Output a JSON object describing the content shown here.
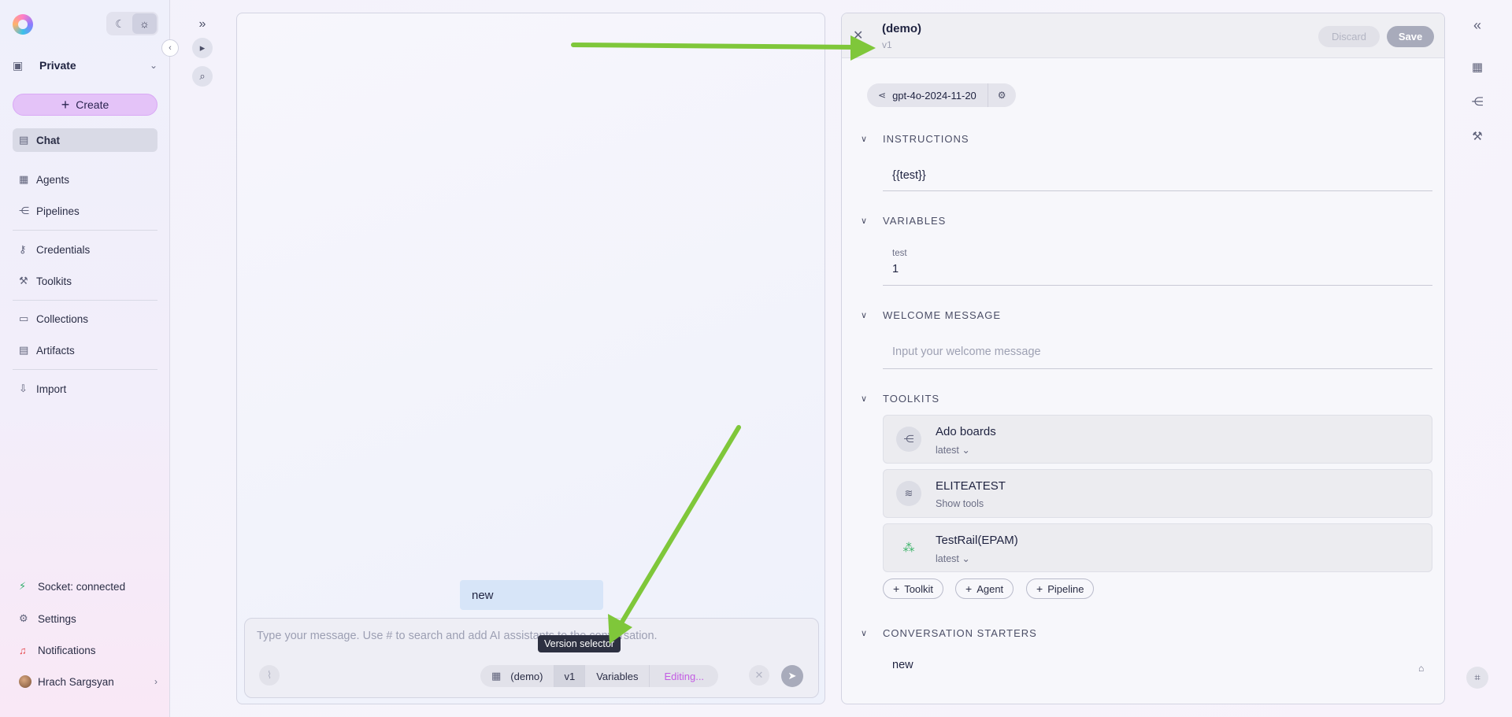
{
  "sidebar": {
    "theme": {
      "dark_icon": "moon-icon",
      "light_icon": "sun-icon"
    },
    "project": "Private",
    "create_label": "Create",
    "nav": {
      "chat": "Chat",
      "agents": "Agents",
      "pipelines": "Pipelines",
      "credentials": "Credentials",
      "toolkits": "Toolkits",
      "collections": "Collections",
      "artifacts": "Artifacts",
      "import": "Import"
    },
    "bottom": {
      "socket": "Socket: connected",
      "settings": "Settings",
      "notifications": "Notifications",
      "user": "Hrach Sargsyan"
    }
  },
  "chat": {
    "message": "new",
    "input_placeholder": "Type your message. Use # to search and add AI assistants to the conversation.",
    "chips": {
      "agent": "(demo)",
      "version": "v1",
      "variables": "Variables",
      "status": "Editing..."
    },
    "tooltip": "Version selector"
  },
  "editor": {
    "agent_name": "(demo)",
    "version": "v1",
    "discard_label": "Discard",
    "save_label": "Save",
    "model": "gpt-4o-2024-11-20",
    "sections": {
      "instructions": "INSTRUCTIONS",
      "variables": "VARIABLES",
      "welcome": "WELCOME MESSAGE",
      "toolkits": "TOOLKITS",
      "starters": "CONVERSATION STARTERS"
    },
    "instructions_value": "{{test}}",
    "variable": {
      "name": "test",
      "value": "1"
    },
    "welcome_placeholder": "Input your welcome message",
    "toolkits": [
      {
        "name": "Ado boards",
        "sub": "latest",
        "icon": "pipeline-icon"
      },
      {
        "name": "ELITEATEST",
        "sub": "Show tools",
        "icon": "mcp-icon"
      },
      {
        "name": "TestRail(EPAM)",
        "sub": "latest",
        "icon": "testrail-icon"
      }
    ],
    "add_buttons": {
      "toolkit": "Toolkit",
      "agent": "Agent",
      "pipeline": "Pipeline"
    },
    "starter": "new"
  },
  "colors": {
    "accent": "#c35ce3",
    "create_bg": "#e4c3f8",
    "arrow": "#7fc73a",
    "active_nav": "#d9dae6"
  }
}
